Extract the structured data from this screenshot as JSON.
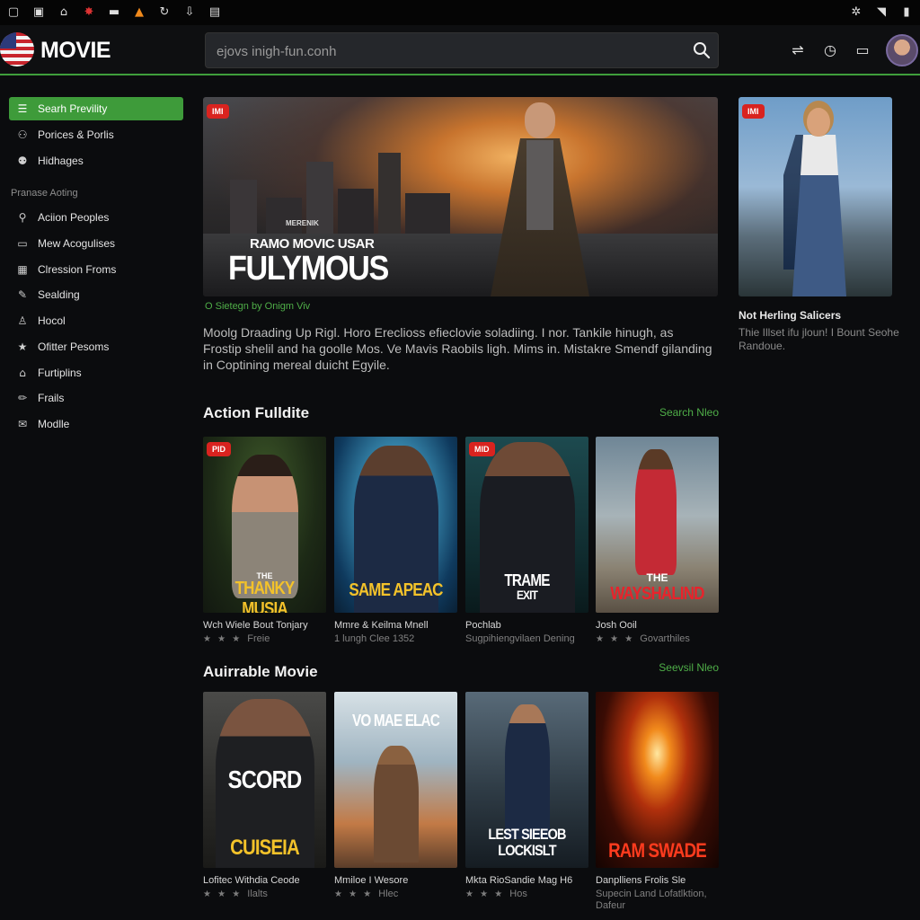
{
  "statusbar": {
    "left_icons": [
      "window-icon",
      "calendar-icon",
      "home-icon",
      "bug-icon",
      "image-icon",
      "cone-icon",
      "refresh-icon",
      "download-icon",
      "b-icon"
    ],
    "right_icons": [
      "bluetooth-icon",
      "wifi-icon",
      "battery-icon"
    ]
  },
  "header": {
    "logo": "MOVIE",
    "search_placeholder": "ejovs inigh-fun.conh"
  },
  "sidebar": {
    "items": [
      {
        "label": "Searh Prevility",
        "icon": "list-icon"
      },
      {
        "label": "Porices & Porlis",
        "icon": "user-icon"
      },
      {
        "label": "Hidhages",
        "icon": "user-icon"
      }
    ],
    "section_label": "Pranase Aoting",
    "section_items": [
      {
        "label": "Aciion Peoples",
        "icon": "pin-icon"
      },
      {
        "label": "Mew Acogulises",
        "icon": "chat-icon"
      },
      {
        "label": "Clression Froms",
        "icon": "film-icon"
      },
      {
        "label": "Sealding",
        "icon": "pen-icon"
      },
      {
        "label": "Hocol",
        "icon": "person-icon"
      },
      {
        "label": "Ofitter Pesoms",
        "icon": "star-icon"
      },
      {
        "label": "Furtiplins",
        "icon": "building-icon"
      },
      {
        "label": "Frails",
        "icon": "pencil-icon"
      },
      {
        "label": "Modlle",
        "icon": "mail-icon"
      }
    ]
  },
  "feature": {
    "badge": "IMI",
    "kicker": "MERENIK",
    "subtitle": "RAMO MOVIC USAR",
    "title": "FULYMOUS",
    "meta": "O Sietegn by Onigm Viv",
    "description": "Moolg Draading Up Rigl. Horo Ereclioss efieclovie soladiing. I nor. Tankile hinugh, as Frostip shelil and ha goolle Mos. Ve Mavis Raobils ligh. Mims in. Mistakre Smendf gilanding in Coptining mereal duicht Egyile."
  },
  "side_feature": {
    "badge": "IMI",
    "title": "Not Herling Salicers",
    "description": "Thie Illset ifu jloun! I Bount Seohe Randoue."
  },
  "section1": {
    "title": "Action Fulldite",
    "link": "Search Nleo",
    "cards": [
      {
        "badge": "PID",
        "poster_top": "THE",
        "poster_title": "THANKY MUSIA",
        "title": "Wch Wiele Bout Tonjary",
        "stars": "★ ★ ★",
        "meta": "Freie"
      },
      {
        "badge": "",
        "poster_top": "",
        "poster_title": "SAME APEAC",
        "title": "Mmre & Keilma Mnell",
        "stars": "",
        "meta": "1 lungh Clee 1352"
      },
      {
        "badge": "MID",
        "poster_top": "TRAME",
        "poster_title": "EXIT",
        "title": "Pochlab",
        "stars": "",
        "meta": "Sugpihiengvilaen Dening"
      },
      {
        "badge": "",
        "poster_top": "THE",
        "poster_title": "WAYSHALIND",
        "title": "Josh Ooil",
        "stars": "★ ★ ★",
        "meta": "Govarthiles"
      }
    ]
  },
  "section2": {
    "title": "Auirrable Movie",
    "link": "Seevsil Nleo",
    "cards": [
      {
        "poster_top": "SCORD",
        "poster_title": "CUISEIA",
        "title": "Lofitec Withdia Ceode",
        "stars": "★ ★ ★",
        "meta": "Ilalts"
      },
      {
        "poster_top": "VO MAE ELAC",
        "poster_title": "",
        "title": "Mmiloe I Wesore",
        "stars": "★ ★ ★",
        "meta": "Hlec"
      },
      {
        "poster_top": "",
        "poster_title": "LEST SIEEOB LOCKISLT",
        "title": "Mkta RioSandie Mag H6",
        "stars": "★ ★ ★",
        "meta": "Hos"
      },
      {
        "poster_top": "",
        "poster_title": "RAM SWADE",
        "title": "Danplliens Frolis Sle",
        "stars": "",
        "meta": "Supecin Land Lofatlktion, Dafeur"
      }
    ]
  },
  "colors": {
    "accent": "#3e9b3a",
    "badge": "#d9231f",
    "link": "#4fae48"
  }
}
